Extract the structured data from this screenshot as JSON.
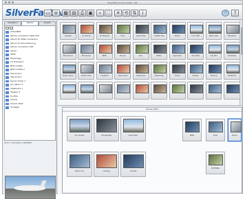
{
  "window": {
    "title": "SilverFast Archive Suite - VLT"
  },
  "logo": {
    "brand": "SilverFast",
    "suffix": "VLT"
  },
  "toolbar": {
    "buttons": [
      {
        "icon": "window-icon",
        "glyph": "▭"
      },
      {
        "icon": "list-view-icon",
        "glyph": "≡"
      },
      {
        "icon": "grid-view-icon",
        "glyph": "▦"
      },
      {
        "icon": "table-view-icon",
        "glyph": "▤"
      },
      {
        "icon": "print-icon",
        "glyph": "⎙"
      },
      {
        "icon": "slideshow-icon",
        "glyph": "▣"
      },
      {
        "icon": "zoom-icon",
        "glyph": "⌕"
      },
      {
        "icon": "fullscreen-icon",
        "glyph": "⛶"
      },
      {
        "icon": "delete-icon",
        "glyph": "✕"
      },
      {
        "icon": "sync-icon",
        "glyph": "⟲"
      },
      {
        "icon": "transfer-icon",
        "glyph": "⇅"
      },
      {
        "icon": "info-icon",
        "glyph": "i"
      }
    ],
    "right_buttons": [
      {
        "icon": "prefs-icon",
        "glyph": "◎"
      },
      {
        "icon": "help-icon",
        "glyph": "?"
      }
    ]
  },
  "sidebar": {
    "tabs": [
      "Navigation",
      "Albums",
      "Presets"
    ],
    "active_tab": 1,
    "tree": [
      "Airbus800",
      "Album conversion table 001",
      "Album for RAW conversion",
      "Album for Konvertierung",
      "Album conversion 001",
      "Aerial",
      "AP03",
      "Physiology",
      "LH Transport",
      "NHS Credits",
      "NHS Credits 2",
      "Sea wing 1",
      "Sea wing 2",
      "Server Tower 1",
      "Srv album 2",
      "Sideboard 1",
      "Sleeper 2",
      "Sunfire",
      "Urlaub",
      "Urlaub 2003",
      "Vorlagen"
    ],
    "preview_caption": "2272 x 1704 Pixel 2.2 MB JPEG"
  },
  "grid": {
    "rows": [
      [
        "Airplane",
        "Air Scenes",
        "Air Museum",
        "Alive",
        "Automotive",
        "Arabian Sea",
        "Athens",
        "Lucid 400",
        "Black Lake",
        "Blueshine"
      ],
      [
        "Bird Church",
        "Bird Scene",
        "BMW",
        "Bronze",
        "Bus",
        "Butter",
        "Cape Town",
        "City 2003",
        "City Hall",
        "Christmas"
      ],
      [
        "Clean carbon",
        "Classic Airpl.",
        "Coastline",
        "Dark Coast",
        "Deep Dark",
        "Desert Sky",
        "Dome",
        "Escape",
        "Evening",
        "Exhibit LH"
      ]
    ],
    "last_row_visible": [
      "",
      "",
      "",
      "",
      "",
      "",
      "",
      "",
      "",
      ""
    ]
  },
  "lower": {
    "header": "Urlaub 2003",
    "left_items": [
      {
        "caption": "Air Scenes"
      },
      {
        "caption": "Cloudscape"
      },
      {
        "caption": "Aerial 001"
      },
      {
        "caption": "Harbor Air"
      },
      {
        "caption": "Landing"
      },
      {
        "caption": "Cockpit"
      }
    ],
    "right_items": [
      {
        "caption": "BMW"
      },
      {
        "caption": "Boat"
      },
      {
        "caption": "Mount"
      },
      {
        "caption": "BUTTONS"
      }
    ]
  }
}
